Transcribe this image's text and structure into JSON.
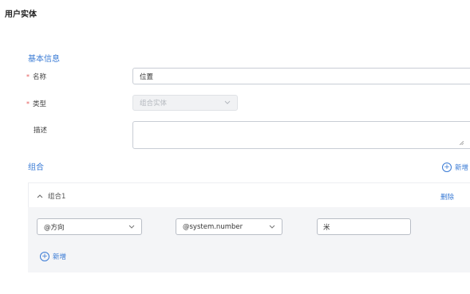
{
  "page": {
    "title": "用户实体"
  },
  "basic_info": {
    "section_title": "基本信息",
    "name": {
      "required_mark": "*",
      "label": "名称",
      "value": "位置"
    },
    "type": {
      "required_mark": "*",
      "label": "类型",
      "value": "组合实体",
      "disabled": true
    },
    "description": {
      "label": "描述",
      "value": ""
    }
  },
  "group_section": {
    "section_title": "组合",
    "add_label": "新增",
    "groups": [
      {
        "title": "组合1",
        "delete_label": "删除",
        "expanded": true,
        "rows": [
          {
            "field_select": "@方向",
            "entity_select": "@system.number",
            "unit_value": "米"
          }
        ],
        "add_label": "新增"
      }
    ]
  },
  "icons": {
    "add": "plus-circle-icon",
    "collapse": "chevron-up-icon",
    "dropdown": "chevron-down-icon"
  },
  "colors": {
    "accent": "#3a7bd5",
    "required": "#e55a5a",
    "panel_bg": "#f4f5f7"
  }
}
